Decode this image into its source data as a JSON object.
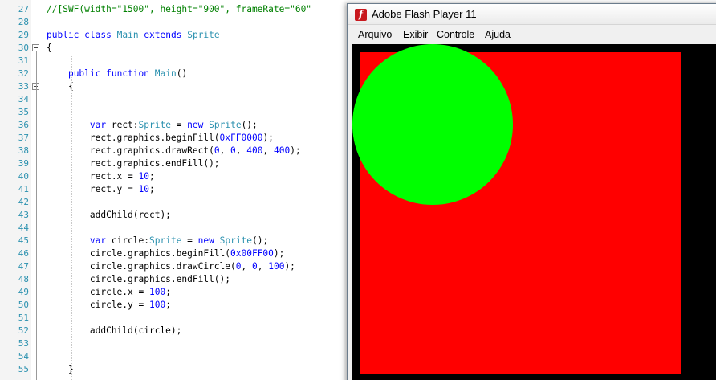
{
  "editor": {
    "lines": [
      {
        "num": "27",
        "tokens": [
          {
            "t": "//[SWF(width=\"1500\", height=\"900\", frameRate=\"60\"",
            "c": "cm"
          }
        ]
      },
      {
        "num": "28",
        "tokens": []
      },
      {
        "num": "29",
        "tokens": [
          {
            "t": "public",
            "c": "kw"
          },
          {
            "t": " "
          },
          {
            "t": "class",
            "c": "kw"
          },
          {
            "t": " "
          },
          {
            "t": "Main",
            "c": "ty"
          },
          {
            "t": " "
          },
          {
            "t": "extends",
            "c": "kw"
          },
          {
            "t": " "
          },
          {
            "t": "Sprite",
            "c": "ty"
          }
        ]
      },
      {
        "num": "30",
        "tokens": [
          {
            "t": "{"
          }
        ]
      },
      {
        "num": "31",
        "tokens": []
      },
      {
        "num": "32",
        "tokens": [
          {
            "t": "    "
          },
          {
            "t": "public",
            "c": "kw"
          },
          {
            "t": " "
          },
          {
            "t": "function",
            "c": "kw"
          },
          {
            "t": " "
          },
          {
            "t": "Main",
            "c": "ty"
          },
          {
            "t": "()"
          }
        ]
      },
      {
        "num": "33",
        "tokens": [
          {
            "t": "    {"
          }
        ]
      },
      {
        "num": "34",
        "tokens": []
      },
      {
        "num": "35",
        "tokens": []
      },
      {
        "num": "36",
        "tokens": [
          {
            "t": "        "
          },
          {
            "t": "var",
            "c": "kw"
          },
          {
            "t": " rect:"
          },
          {
            "t": "Sprite",
            "c": "ty"
          },
          {
            "t": " = "
          },
          {
            "t": "new",
            "c": "kw"
          },
          {
            "t": " "
          },
          {
            "t": "Sprite",
            "c": "ty"
          },
          {
            "t": "();"
          }
        ]
      },
      {
        "num": "37",
        "tokens": [
          {
            "t": "        rect.graphics.beginFill("
          },
          {
            "t": "0xFF0000",
            "c": "nm"
          },
          {
            "t": ");"
          }
        ]
      },
      {
        "num": "38",
        "tokens": [
          {
            "t": "        rect.graphics.drawRect("
          },
          {
            "t": "0",
            "c": "nm"
          },
          {
            "t": ", "
          },
          {
            "t": "0",
            "c": "nm"
          },
          {
            "t": ", "
          },
          {
            "t": "400",
            "c": "nm"
          },
          {
            "t": ", "
          },
          {
            "t": "400",
            "c": "nm"
          },
          {
            "t": ");"
          }
        ]
      },
      {
        "num": "39",
        "tokens": [
          {
            "t": "        rect.graphics.endFill();"
          }
        ]
      },
      {
        "num": "40",
        "tokens": [
          {
            "t": "        rect.x = "
          },
          {
            "t": "10",
            "c": "nm"
          },
          {
            "t": ";"
          }
        ]
      },
      {
        "num": "41",
        "tokens": [
          {
            "t": "        rect.y = "
          },
          {
            "t": "10",
            "c": "nm"
          },
          {
            "t": ";"
          }
        ]
      },
      {
        "num": "42",
        "tokens": []
      },
      {
        "num": "43",
        "tokens": [
          {
            "t": "        addChild(rect);"
          }
        ]
      },
      {
        "num": "44",
        "tokens": []
      },
      {
        "num": "45",
        "tokens": [
          {
            "t": "        "
          },
          {
            "t": "var",
            "c": "kw"
          },
          {
            "t": " circle:"
          },
          {
            "t": "Sprite",
            "c": "ty"
          },
          {
            "t": " = "
          },
          {
            "t": "new",
            "c": "kw"
          },
          {
            "t": " "
          },
          {
            "t": "Sprite",
            "c": "ty"
          },
          {
            "t": "();"
          }
        ]
      },
      {
        "num": "46",
        "tokens": [
          {
            "t": "        circle.graphics.beginFill("
          },
          {
            "t": "0x00FF00",
            "c": "nm"
          },
          {
            "t": ");"
          }
        ]
      },
      {
        "num": "47",
        "tokens": [
          {
            "t": "        circle.graphics.drawCircle("
          },
          {
            "t": "0",
            "c": "nm"
          },
          {
            "t": ", "
          },
          {
            "t": "0",
            "c": "nm"
          },
          {
            "t": ", "
          },
          {
            "t": "100",
            "c": "nm"
          },
          {
            "t": ");"
          }
        ]
      },
      {
        "num": "48",
        "tokens": [
          {
            "t": "        circle.graphics.endFill();"
          }
        ]
      },
      {
        "num": "49",
        "tokens": [
          {
            "t": "        circle.x = "
          },
          {
            "t": "100",
            "c": "nm"
          },
          {
            "t": ";"
          }
        ]
      },
      {
        "num": "50",
        "tokens": [
          {
            "t": "        circle.y = "
          },
          {
            "t": "100",
            "c": "nm"
          },
          {
            "t": ";"
          }
        ]
      },
      {
        "num": "51",
        "tokens": []
      },
      {
        "num": "52",
        "tokens": [
          {
            "t": "        addChild(circle);"
          }
        ]
      },
      {
        "num": "53",
        "tokens": []
      },
      {
        "num": "54",
        "tokens": []
      },
      {
        "num": "55",
        "tokens": [
          {
            "t": "    }"
          }
        ]
      }
    ]
  },
  "flash_window": {
    "title": "Adobe Flash Player 11",
    "icon": "flash-player-icon",
    "icon_glyph": "f",
    "menu": [
      "Arquivo",
      "Exibir",
      "Controle",
      "Ajuda"
    ]
  },
  "stage": {
    "background": "#000000",
    "rect_color": "#FF0000",
    "circle_color": "#00FF00"
  }
}
